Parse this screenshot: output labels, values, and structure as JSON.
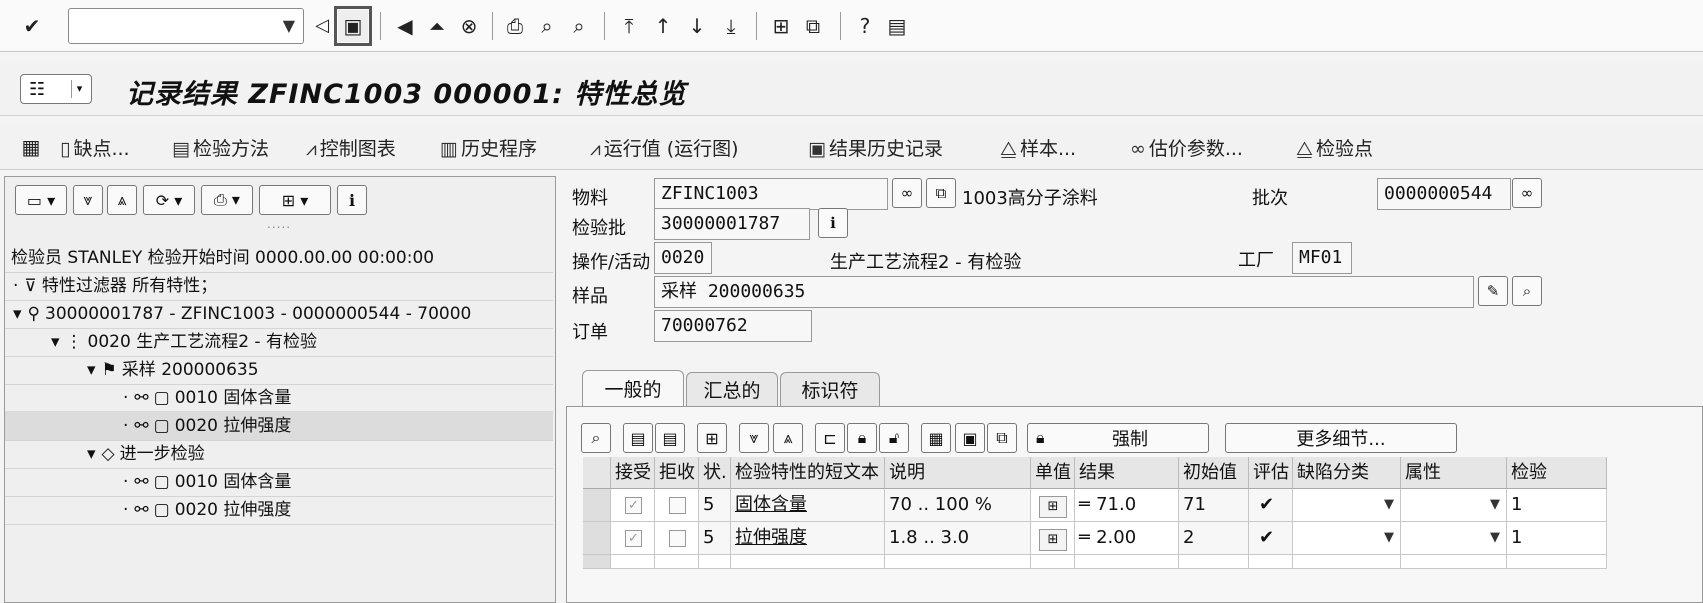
{
  "toolbar": {
    "command_field_value": "",
    "icons": [
      "enter-icon",
      "back-icon",
      "save-icon",
      "back-nav-icon",
      "exit-icon",
      "cancel-icon",
      "print-icon",
      "find-icon",
      "find-next-icon",
      "first-page-icon",
      "prev-page-icon",
      "next-page-icon",
      "last-page-icon",
      "new-session-icon",
      "shortcut-icon",
      "help-icon",
      "layout-icon"
    ]
  },
  "title_bar": {
    "title": "记录结果 ZFINC1003 000001: 特性总览"
  },
  "app_toolbar": {
    "defects": "缺点...",
    "inspection_method": "检验方法",
    "control_chart": "控制图表",
    "history": "历史程序",
    "run_chart": "运行值 (运行图)",
    "result_history": "结果历史记录",
    "sample": "样本...",
    "valuation_params": "估价参数...",
    "inspection_point": "检验点"
  },
  "left_panel": {
    "dots": ".....",
    "rows": [
      {
        "text": "检验员 STANLEY 检验开始时间 0000.00.00 00:00:00"
      },
      {
        "prefix": "·",
        "icon": "filter-icon",
        "text": "特性过滤器 所有特性；"
      },
      {
        "prefix": "▾",
        "icon": "lot-icon",
        "text": "30000001787 - ZFINC1003 - 0000000544 - 70000"
      },
      {
        "prefix": "▾",
        "icon": "operation-icon",
        "text": "0020 生产工艺流程2 - 有检验"
      },
      {
        "prefix": "▾",
        "icon": "sample-flag-icon",
        "text": "采样 200000635"
      },
      {
        "prefix": "·",
        "icon": "characteristic-icon",
        "text": "0010 固体含量"
      },
      {
        "prefix": "·",
        "icon": "characteristic-icon",
        "text": "0020 拉伸强度"
      },
      {
        "prefix": "▾",
        "icon": "diamond-icon",
        "text": "进一步检验"
      },
      {
        "prefix": "·",
        "icon": "characteristic-icon",
        "text": "0010 固体含量"
      },
      {
        "prefix": "·",
        "icon": "characteristic-icon",
        "text": "0020 拉伸强度"
      }
    ]
  },
  "header": {
    "material_label": "物料",
    "material_value": "ZFINC1003",
    "material_desc": "1003高分子涂料",
    "batch_label": "批次",
    "batch_value": "0000000544",
    "lot_label": "检验批",
    "lot_value": "30000001787",
    "operation_label": "操作/活动",
    "operation_value": "0020",
    "operation_desc": "生产工艺流程2 - 有检验",
    "plant_label": "工厂",
    "plant_value": "MF01",
    "sample_label": "样品",
    "sample_value": "采样 200000635",
    "order_label": "订单",
    "order_value": "70000762"
  },
  "tabs": {
    "general": "一般的",
    "summary": "汇总的",
    "identifier": "标识符"
  },
  "grid_toolbar": {
    "force": "强制",
    "more_details": "更多细节..."
  },
  "grid": {
    "columns": [
      "接受",
      "拒收",
      "状.",
      "检验特性的短文本",
      "说明",
      "单值",
      "结果",
      "初始值",
      "评估",
      "缺陷分类",
      "属性",
      "检验"
    ],
    "rows": [
      {
        "status": "5",
        "text": "固体含量",
        "desc": "70 .. 100 %",
        "result": "71.0",
        "initial": "71",
        "valuation": "✔",
        "inspect": "1"
      },
      {
        "status": "5",
        "text": "拉伸强度",
        "desc": "1.8 .. 3.0",
        "result": "2.00",
        "initial": "2",
        "valuation": "✔",
        "inspect": "1"
      }
    ]
  }
}
